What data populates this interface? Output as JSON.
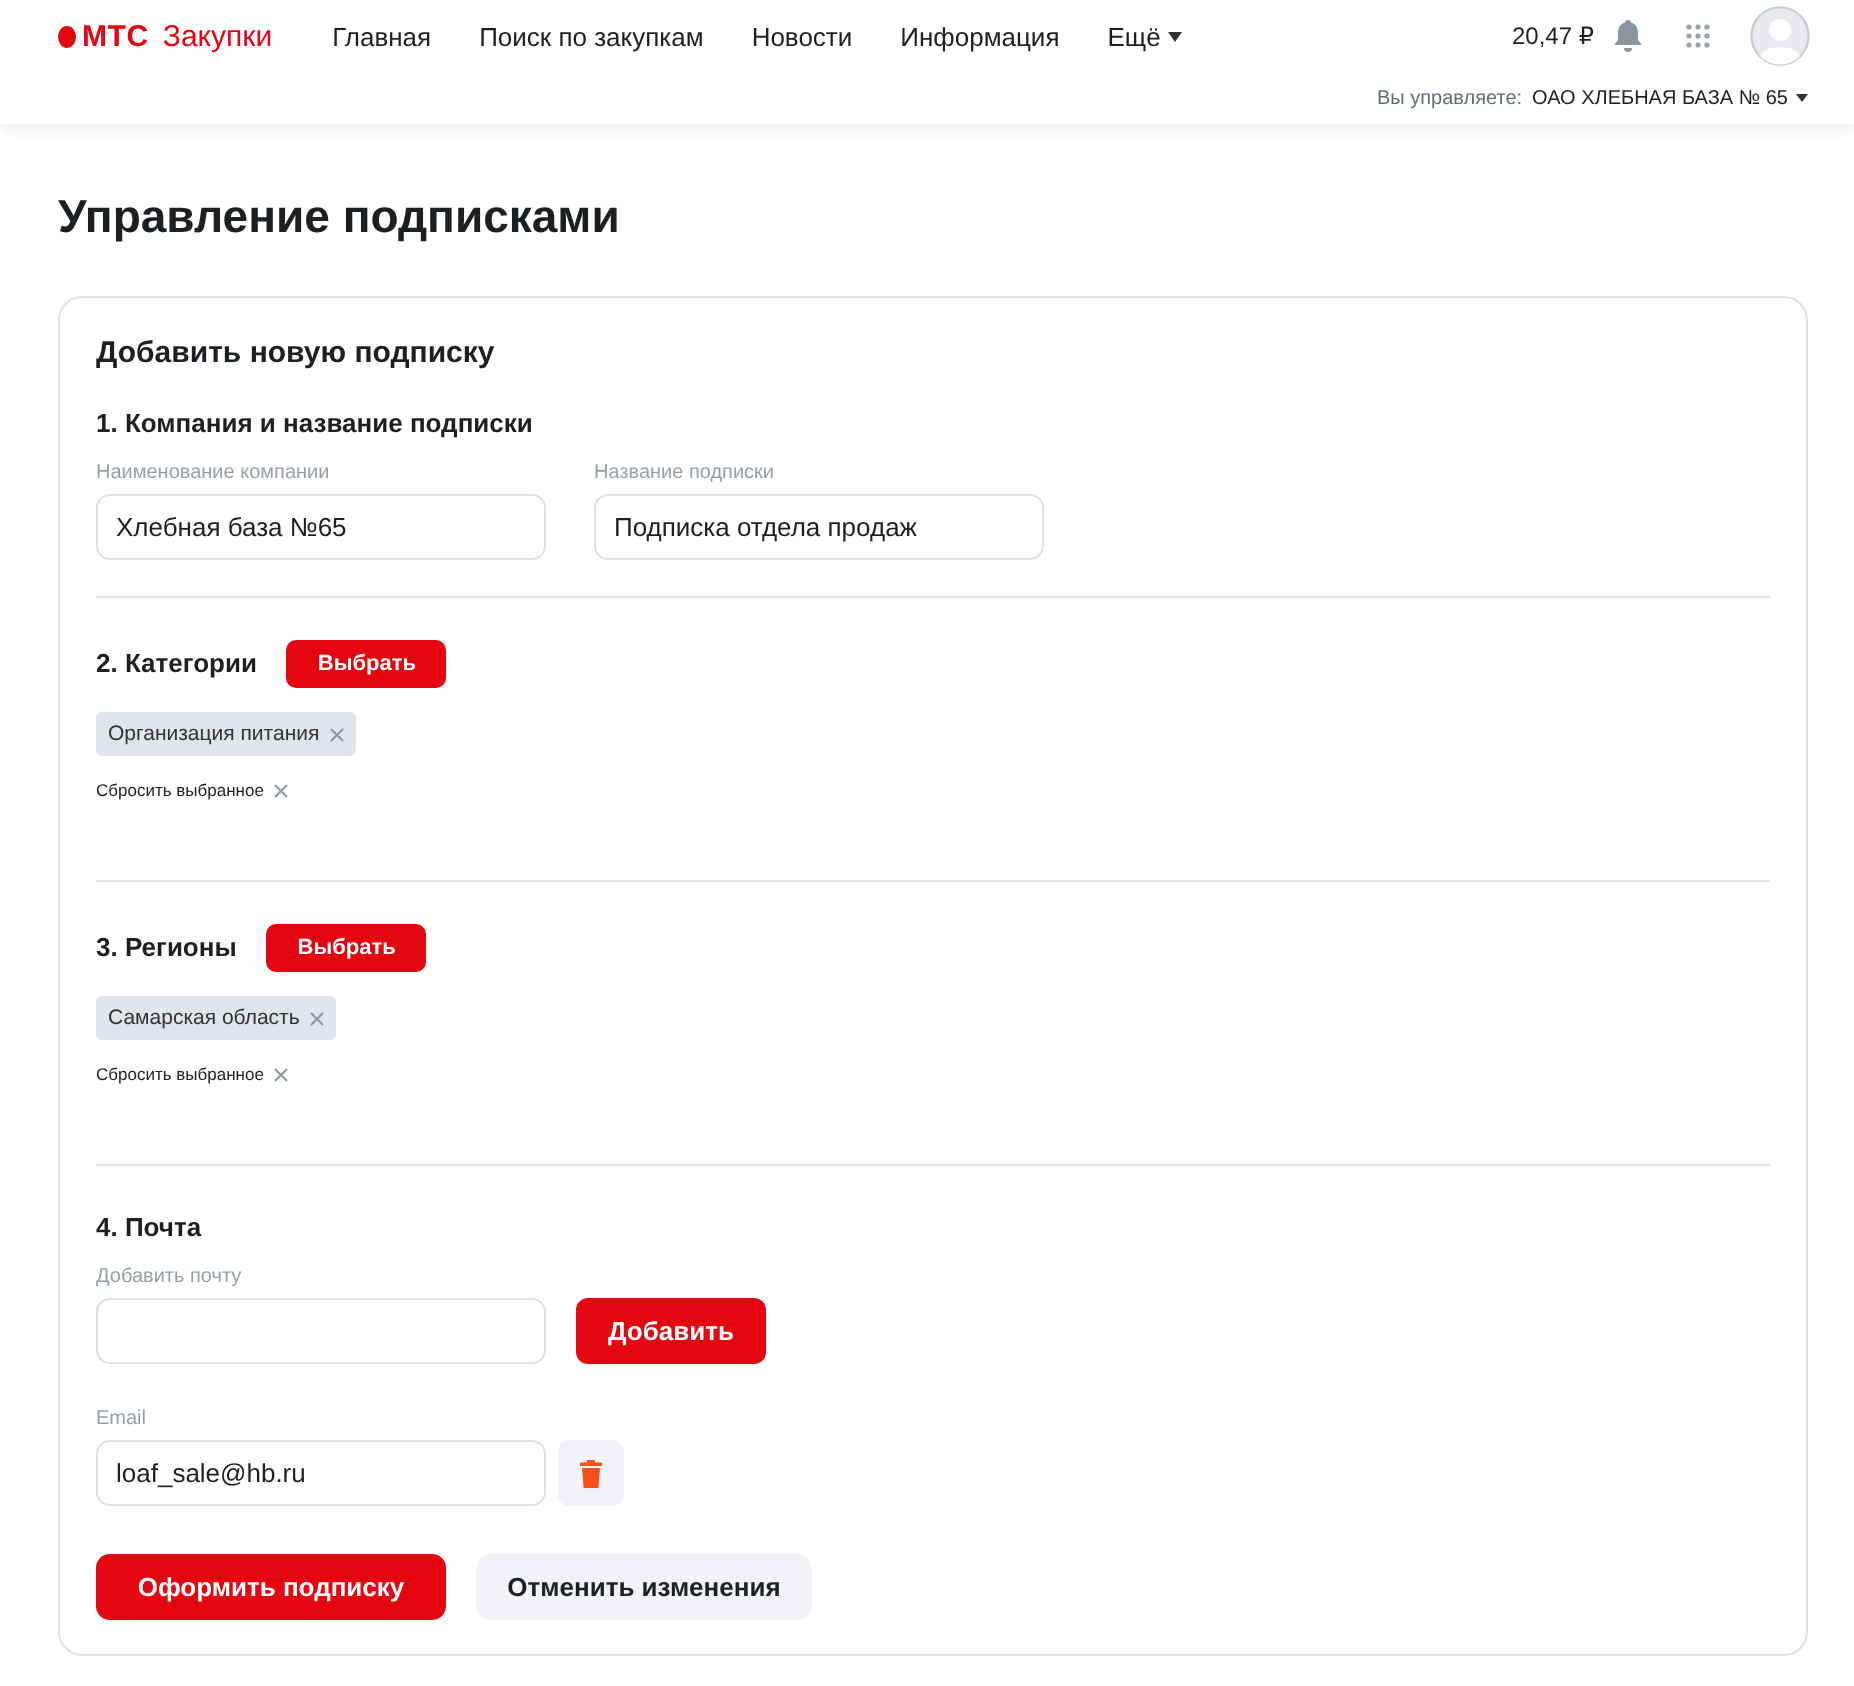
{
  "header": {
    "logo": {
      "brand": "МТС",
      "name": "Закупки"
    },
    "nav": [
      {
        "label": "Главная"
      },
      {
        "label": "Поиск по закупкам"
      },
      {
        "label": "Новости"
      },
      {
        "label": "Информация"
      }
    ],
    "more": "Ещё",
    "balance": "20,47 ₽",
    "managing_label": "Вы управляете:",
    "managing_org": "ОАО ХЛЕБНАЯ БАЗА № 65"
  },
  "page_title": "Управление подписками",
  "form": {
    "title": "Добавить новую подписку",
    "company_section": {
      "heading": "1. Компания и название подписки",
      "fields": [
        {
          "label": "Наименование компании",
          "value": "Хлебная база №65"
        },
        {
          "label": "Название подписки",
          "value": "Подписка отдела продаж"
        }
      ]
    },
    "picker_sections": [
      {
        "heading": "2. Категории",
        "button": "Выбрать",
        "tags": [
          "Организация питания"
        ],
        "reset": "Сбросить выбранное"
      },
      {
        "heading": "3. Регионы",
        "button": "Выбрать",
        "tags": [
          "Самарская область"
        ],
        "reset": "Сбросить выбранное"
      }
    ],
    "email_section": {
      "heading": "4. Почта",
      "add_label": "Добавить почту",
      "add_button": "Добавить",
      "emails": [
        {
          "label": "Email",
          "value": "loaf_sale@hb.ru"
        }
      ]
    },
    "actions": {
      "submit": "Оформить подписку",
      "cancel": "Отменить изменения"
    }
  }
}
